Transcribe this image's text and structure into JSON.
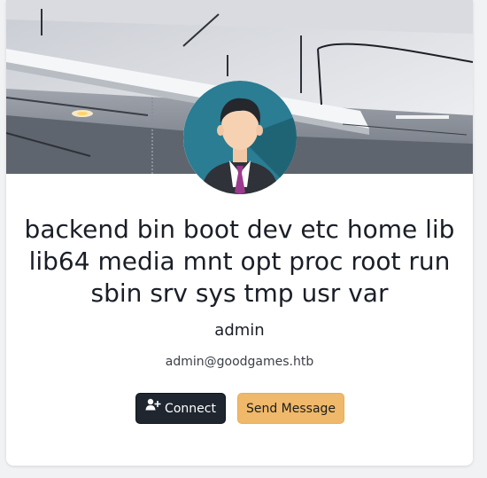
{
  "profile": {
    "name": "backend bin boot dev etc home lib lib64 media mnt opt proc root run sbin srv sys tmp usr var",
    "username": "admin",
    "email": "admin@goodgames.htb"
  },
  "actions": {
    "connect_label": "Connect",
    "connect_icon": "user-plus-icon",
    "message_label": "Send Message"
  },
  "colors": {
    "connect_bg": "#1f2630",
    "message_bg": "#efb86a"
  }
}
